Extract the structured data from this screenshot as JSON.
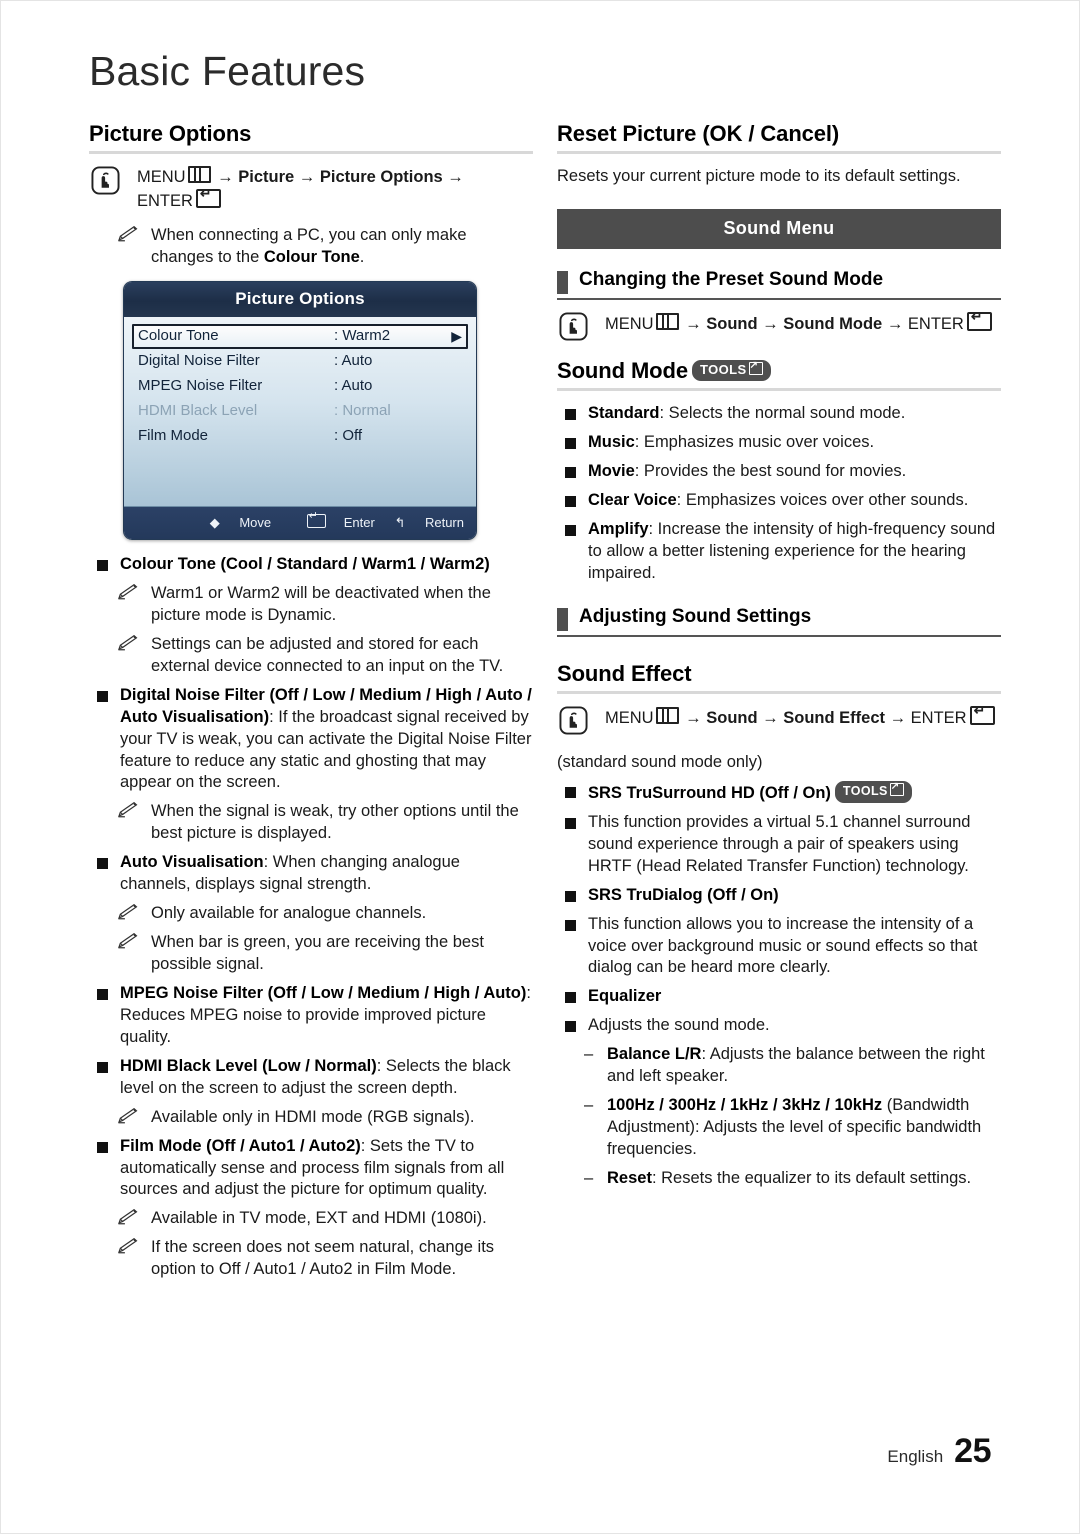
{
  "page": {
    "masthead_title": "Basic Features",
    "footer_language": "English",
    "footer_page_number": "25",
    "accent_band_color": "#4d4d4d",
    "rule_color": "#d8d8d8",
    "osd_header_color": "#1d2e47"
  },
  "left_column": {
    "heading": "Picture Options",
    "menu_path": {
      "prefix": "MENU",
      "menu_icon": "menu-grid-icon",
      "steps": " → Picture → Picture Options → ",
      "enter_label": "ENTER",
      "enter_icon": "enter-key-icon"
    },
    "note_pc": {
      "text_before": "When connecting a PC, you can only make changes to the ",
      "bold": "Colour Tone",
      "text_after": "."
    },
    "osd": {
      "title": "Picture Options",
      "rows": [
        {
          "label": "Colour Tone",
          "value": ": Warm2",
          "selected": true,
          "dim": false,
          "arrow": "▶"
        },
        {
          "label": "Digital Noise Filter",
          "value": ": Auto",
          "selected": false,
          "dim": false,
          "arrow": ""
        },
        {
          "label": "MPEG Noise Filter",
          "value": ": Auto",
          "selected": false,
          "dim": false,
          "arrow": ""
        },
        {
          "label": "HDMI Black Level",
          "value": ": Normal",
          "selected": false,
          "dim": true,
          "arrow": ""
        },
        {
          "label": "Film Mode",
          "value": ": Off",
          "selected": false,
          "dim": false,
          "arrow": ""
        }
      ],
      "footer": {
        "move": "Move",
        "move_icon": "up-down-arrow-icon",
        "enter": "Enter",
        "enter_icon": "enter-key-icon",
        "return": "Return",
        "return_icon": "return-arrow-icon"
      }
    },
    "items": {
      "colour_tone": {
        "title": "Colour Tone (Cool / Standard / Warm1 / Warm2)",
        "notes": [
          "Warm1 or Warm2 will be deactivated when the picture mode is Dynamic.",
          "Settings can be adjusted and stored for each external device connected to an input on the TV."
        ]
      },
      "digital_noise_filter": {
        "title": "Digital Noise Filter (Off / Low / Medium / High / Auto / Auto Visualisation)",
        "body": ": If the broadcast signal received by your TV is weak, you can activate the Digital Noise Filter feature to reduce any static and ghosting that may appear on the screen.",
        "note": "When the signal is weak, try other options until the best picture is displayed.",
        "auto_vis_title": "Auto Visualisation",
        "auto_vis_body": ": When changing analogue channels, displays signal strength.",
        "auto_vis_notes": [
          "Only available for analogue channels.",
          "When bar is green, you are receiving the best possible signal."
        ]
      },
      "mpeg_noise_filter": {
        "title": "MPEG Noise Filter (Off / Low / Medium / High / Auto)",
        "body": ": Reduces MPEG noise to provide improved picture quality."
      },
      "hdmi_black_level": {
        "title": "HDMI Black Level (Low / Normal)",
        "body": ": Selects the black level on the screen to adjust the screen depth.",
        "note": "Available only in HDMI mode (RGB signals)."
      },
      "film_mode": {
        "title": "Film Mode (Off / Auto1 / Auto2)",
        "body": ": Sets the TV to automatically sense and process film signals from all sources and adjust the picture for optimum quality.",
        "notes": [
          "Available in TV mode, EXT and HDMI (1080i).",
          "If the screen does not seem natural, change its option to Off / Auto1 / Auto2 in Film Mode."
        ]
      }
    }
  },
  "right_column": {
    "reset_picture": {
      "heading": "Reset Picture (OK / Cancel)",
      "body": "Resets your current picture mode to its default settings."
    },
    "sound_menu_band": "Sound Menu",
    "changing_preset": {
      "heading": "Changing the Preset Sound Mode",
      "menu_path": {
        "prefix": "MENU",
        "steps": " → Sound → Sound Mode → ",
        "enter_label": "ENTER"
      }
    },
    "sound_mode": {
      "heading": "Sound Mode",
      "tools_badge": "TOOLS",
      "items": [
        {
          "name": "Standard",
          "desc": ": Selects the normal sound mode."
        },
        {
          "name": "Music",
          "desc": ": Emphasizes music over voices."
        },
        {
          "name": "Movie",
          "desc": ": Provides the best sound for movies."
        },
        {
          "name": "Clear Voice",
          "desc": ": Emphasizes voices over other sounds."
        },
        {
          "name": "Amplify",
          "desc": ": Increase the intensity of high-frequency sound to allow a better listening experience for the hearing impaired."
        }
      ]
    },
    "adjusting_sound_settings": {
      "heading": "Adjusting Sound Settings"
    },
    "sound_effect": {
      "heading": "Sound Effect",
      "menu_path": {
        "prefix": "MENU",
        "steps": " → Sound → Sound Effect → ",
        "enter_label": "ENTER"
      },
      "condition": "(standard sound mode only)",
      "trusurround": {
        "title": "SRS TruSurround HD (Off / On)",
        "tools_badge": "TOOLS",
        "body": "This function provides a virtual 5.1 channel surround sound experience through a pair of speakers using HRTF (Head Related Transfer Function) technology."
      },
      "trudialog": {
        "title": "SRS TruDialog (Off / On)",
        "body": "This function allows you to increase the intensity of a voice over background music or sound effects so that dialog can be heard more clearly."
      },
      "equalizer": {
        "title": "Equalizer",
        "body": "Adjusts the sound mode.",
        "sub_items": [
          {
            "name": "Balance L/R",
            "desc": ": Adjusts the balance between the right and left speaker."
          },
          {
            "name": "100Hz / 300Hz / 1kHz / 3kHz / 10kHz",
            "desc": " (Bandwidth Adjustment): Adjusts the level of specific bandwidth frequencies."
          },
          {
            "name": "Reset",
            "desc": ": Resets the equalizer to its default settings."
          }
        ]
      }
    }
  }
}
